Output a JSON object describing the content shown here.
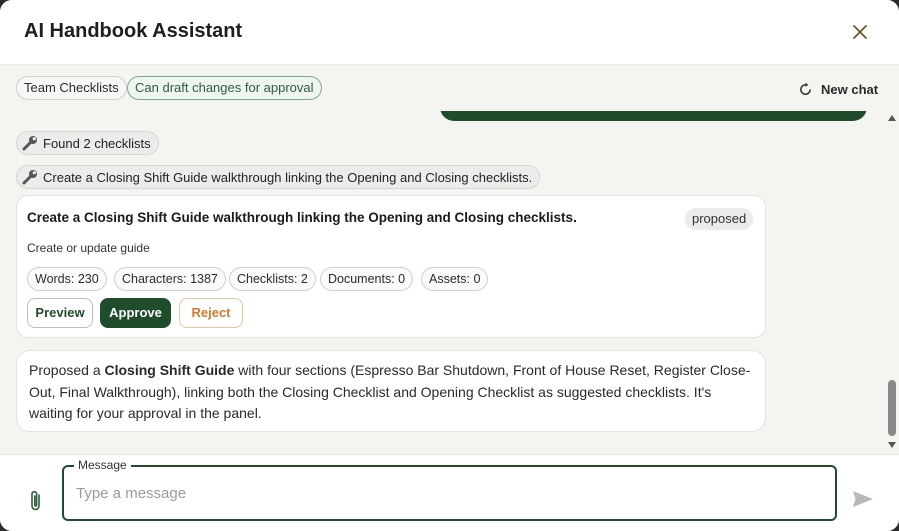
{
  "header": {
    "title": "AI Handbook Assistant",
    "close_icon": "close-icon"
  },
  "toolbar": {
    "chips": [
      "Team Checklists",
      "Can draft changes for approval"
    ],
    "new_chat_label": "New chat",
    "new_chat_icon": "refresh-icon"
  },
  "chat": {
    "tool_events": [
      "Found 2 checklists",
      "Create a Closing Shift Guide walkthrough linking the Opening and Closing checklists."
    ],
    "proposal": {
      "title": "Create a Closing Shift Guide walkthrough linking the Opening and Closing checklists.",
      "status": "proposed",
      "subtitle": "Create or update guide",
      "stats": [
        "Words: 230",
        "Characters: 1387",
        "Checklists: 2",
        "Documents: 0",
        "Assets: 0"
      ],
      "preview_label": "Preview",
      "approve_label": "Approve",
      "reject_label": "Reject"
    },
    "assistant_message": {
      "prefix": "Proposed a ",
      "bold": "Closing Shift Guide",
      "suffix": " with four sections (Espresso Bar Shutdown, Front of House Reset, Register Close-Out, Final Walkthrough), linking both the Closing Checklist and Opening Checklist as suggested checklists. It's waiting for your approval in the panel."
    }
  },
  "composer": {
    "label": "Message",
    "placeholder": "Type a message",
    "value": ""
  },
  "colors": {
    "accent": "#1f4d2c",
    "reject": "#d9782b",
    "background": "#f4f4f1"
  }
}
